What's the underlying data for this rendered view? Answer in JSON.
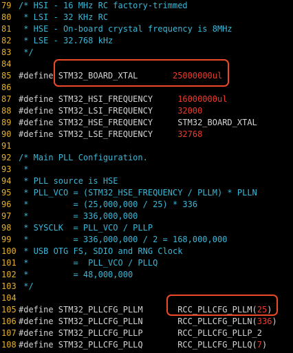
{
  "colors": {
    "background": "#000000",
    "line_number": "#e8b12a",
    "comment": "#3ab8d8",
    "text": "#d4d4d4",
    "number": "#ee3b2b",
    "highlight_box": "#ee4a2a"
  },
  "lines": [
    {
      "n": "79",
      "segs": [
        {
          "t": "/* HSI - 16 MHz RC factory-trimmed",
          "c": "comment"
        }
      ]
    },
    {
      "n": "80",
      "segs": [
        {
          "t": " * LSI - 32 KHz RC",
          "c": "comment"
        }
      ]
    },
    {
      "n": "81",
      "segs": [
        {
          "t": " * HSE - On-board crystal frequency is 8MHz",
          "c": "comment"
        }
      ]
    },
    {
      "n": "82",
      "segs": [
        {
          "t": " * LSE - 32.768 kHz",
          "c": "comment"
        }
      ]
    },
    {
      "n": "83",
      "segs": [
        {
          "t": " */",
          "c": "comment"
        }
      ]
    },
    {
      "n": "84",
      "segs": []
    },
    {
      "n": "85",
      "segs": [
        {
          "t": "#define ",
          "c": "pp"
        },
        {
          "t": "STM32_BOARD_XTAL       ",
          "c": "ident"
        },
        {
          "t": "25000000ul",
          "c": "num"
        }
      ]
    },
    {
      "n": "86",
      "segs": []
    },
    {
      "n": "87",
      "segs": [
        {
          "t": "#define ",
          "c": "pp"
        },
        {
          "t": "STM32_HSI_FREQUENCY     ",
          "c": "ident"
        },
        {
          "t": "16000000ul",
          "c": "num"
        }
      ]
    },
    {
      "n": "88",
      "segs": [
        {
          "t": "#define ",
          "c": "pp"
        },
        {
          "t": "STM32_LSI_FREQUENCY     ",
          "c": "ident"
        },
        {
          "t": "32000",
          "c": "num"
        }
      ]
    },
    {
      "n": "89",
      "segs": [
        {
          "t": "#define ",
          "c": "pp"
        },
        {
          "t": "STM32_HSE_FREQUENCY     STM32_BOARD_XTAL",
          "c": "ident"
        }
      ]
    },
    {
      "n": "90",
      "segs": [
        {
          "t": "#define ",
          "c": "pp"
        },
        {
          "t": "STM32_LSE_FREQUENCY     ",
          "c": "ident"
        },
        {
          "t": "32768",
          "c": "num"
        }
      ]
    },
    {
      "n": "91",
      "segs": []
    },
    {
      "n": "92",
      "segs": [
        {
          "t": "/* Main PLL Configuration.",
          "c": "comment"
        }
      ]
    },
    {
      "n": "93",
      "segs": [
        {
          "t": " *",
          "c": "comment"
        }
      ]
    },
    {
      "n": "94",
      "segs": [
        {
          "t": " * PLL source is HSE",
          "c": "comment"
        }
      ]
    },
    {
      "n": "95",
      "segs": [
        {
          "t": " * PLL_VCO = (STM32_HSE_FREQUENCY / PLLM) * PLLN",
          "c": "comment"
        }
      ]
    },
    {
      "n": "96",
      "segs": [
        {
          "t": " *         = (25,000,000 / 25) * 336",
          "c": "comment"
        }
      ]
    },
    {
      "n": "97",
      "segs": [
        {
          "t": " *         = 336,000,000",
          "c": "comment"
        }
      ]
    },
    {
      "n": "98",
      "segs": [
        {
          "t": " * SYSCLK  = PLL_VCO / PLLP",
          "c": "comment"
        }
      ]
    },
    {
      "n": "99",
      "segs": [
        {
          "t": " *         = 336,000,000 / 2 = 168,000,000",
          "c": "comment"
        }
      ]
    },
    {
      "n": "100",
      "segs": [
        {
          "t": " * USB OTG FS, SDIO and RNG Clock",
          "c": "comment"
        }
      ]
    },
    {
      "n": "101",
      "segs": [
        {
          "t": " *         =  PLL_VCO / PLLQ",
          "c": "comment"
        }
      ]
    },
    {
      "n": "102",
      "segs": [
        {
          "t": " *         = 48,000,000",
          "c": "comment"
        }
      ]
    },
    {
      "n": "103",
      "segs": [
        {
          "t": " */",
          "c": "comment"
        }
      ]
    },
    {
      "n": "104",
      "segs": []
    },
    {
      "n": "105",
      "segs": [
        {
          "t": "#define ",
          "c": "pp"
        },
        {
          "t": "STM32_PLLCFG_PLLM       RCC_PLLCFG_PLLM(",
          "c": "ident"
        },
        {
          "t": "25",
          "c": "num"
        },
        {
          "t": ")",
          "c": "ident"
        }
      ]
    },
    {
      "n": "106",
      "segs": [
        {
          "t": "#define ",
          "c": "pp"
        },
        {
          "t": "STM32_PLLCFG_PLLN       RCC_PLLCFG_PLLN(",
          "c": "ident"
        },
        {
          "t": "336",
          "c": "num"
        },
        {
          "t": ")",
          "c": "ident"
        }
      ]
    },
    {
      "n": "107",
      "segs": [
        {
          "t": "#define ",
          "c": "pp"
        },
        {
          "t": "STM32_PLLCFG_PLLP       RCC_PLLCFG_PLLP_2",
          "c": "ident"
        }
      ]
    },
    {
      "n": "108",
      "segs": [
        {
          "t": "#define ",
          "c": "pp"
        },
        {
          "t": "STM32_PLLCFG_PLLQ       RCC_PLLCFG_PLLQ(",
          "c": "ident"
        },
        {
          "t": "7",
          "c": "num"
        },
        {
          "t": ")",
          "c": "ident"
        }
      ]
    }
  ]
}
